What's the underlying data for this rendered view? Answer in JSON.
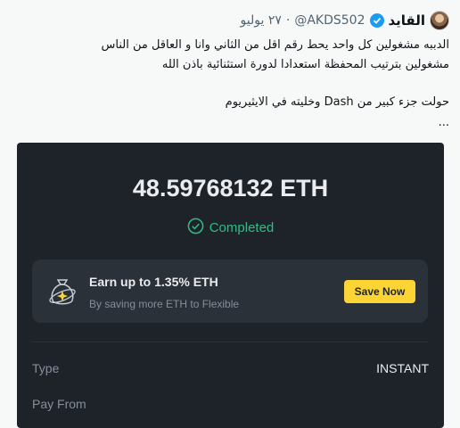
{
  "tweet": {
    "display_name": "القايد",
    "handle": "@AKDS502",
    "separator": "·",
    "date": "٢٧ يوليو",
    "body_lines": [
      "الدببه مشغولين كل واحد يحط رقم اقل من الثاني وانا و العاقل من الناس",
      "مشغولين بترتيب المحفظة استعدادا لدورة استثنائية باذن الله",
      "حولت جزء كبير من Dash وخليته في الايثيريوم",
      "..."
    ]
  },
  "receipt": {
    "amount": "48.59768132 ETH",
    "status": "Completed",
    "promo": {
      "title": "Earn up to 1.35% ETH",
      "subtitle": "By saving more ETH to Flexible",
      "button": "Save Now"
    },
    "rows": [
      {
        "label": "Type",
        "value": "INSTANT"
      },
      {
        "label": "Pay From",
        "value": ""
      }
    ]
  },
  "colors": {
    "card_bg": "#1e2329",
    "accent_yellow": "#fcd535",
    "success_green": "#2ebd85",
    "verified_blue": "#1d9bf0"
  }
}
